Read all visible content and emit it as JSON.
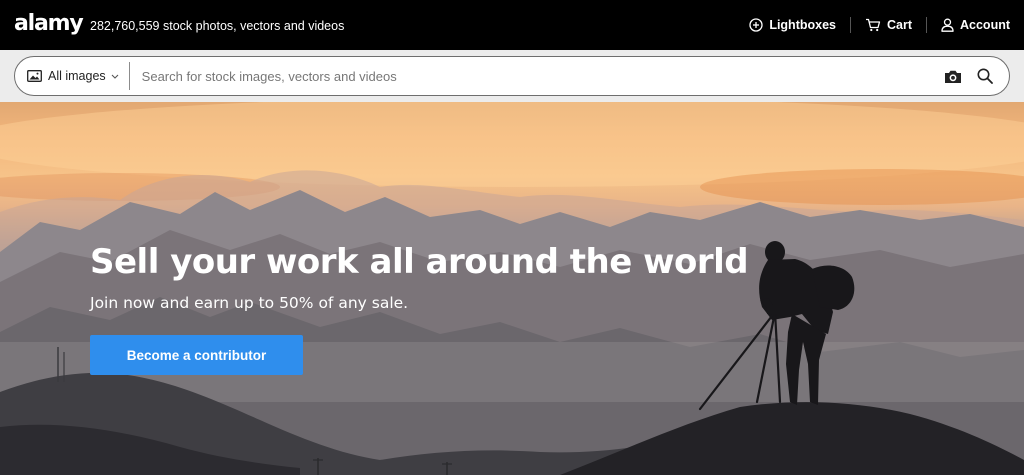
{
  "brand": {
    "logo": "alamy",
    "tagline": "282,760,559 stock photos, vectors and videos"
  },
  "topnav": {
    "lightboxes": "Lightboxes",
    "cart": "Cart",
    "account": "Account"
  },
  "search": {
    "scope_label": "All images",
    "placeholder": "Search for stock images, vectors and videos",
    "value": ""
  },
  "hero": {
    "title": "Sell your work all around the world",
    "subtitle": "Join now and earn up to 50% of any sale.",
    "cta_label": "Become a contributor"
  },
  "colors": {
    "topbar": "#000000",
    "search_strip": "#ececec",
    "cta": "#2f8eed"
  },
  "icons": [
    "plus-circle-icon",
    "cart-icon",
    "user-icon",
    "image-icon",
    "chevron-down-icon",
    "camera-search-icon",
    "search-icon"
  ]
}
